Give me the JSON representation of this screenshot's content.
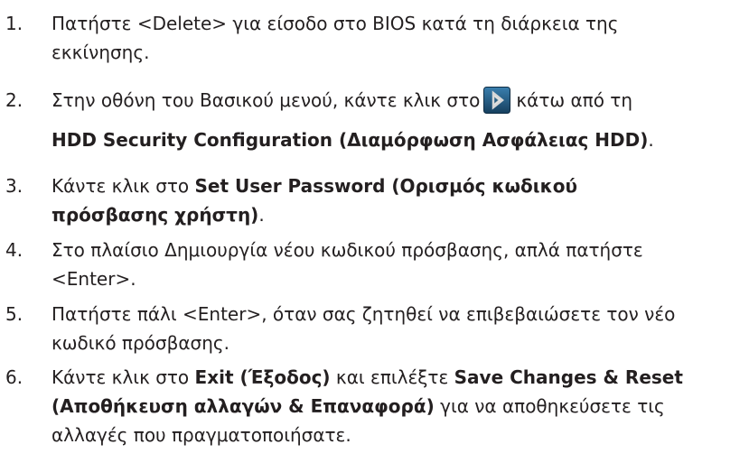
{
  "steps": [
    {
      "number": "1.",
      "lines": [
        "Πατήστε <Delete> για είσοδο στο BIOS κατά τη διάρκεια της",
        "εκκίνησης."
      ]
    },
    {
      "number": "2.",
      "line1_before": "Στην οθόνη του Βασικού μενού, κάντε κλικ στο",
      "line1_after": "κάτω από τη",
      "line2_bold": "HDD Security Configuration (Διαμόρφωση Ασφάλειας HDD)",
      "line2_tail": ".",
      "icon": "arrow-right-button-icon"
    },
    {
      "number": "3.",
      "plain": "Κάντε κλικ στο ",
      "bold1": "Set User Password (Ορισμός κωδικού",
      "bold2": "πρόσβασης χρήστη)",
      "tail": "."
    },
    {
      "number": "4.",
      "lines": [
        "Στο πλαίσιο Δημιουργία νέου κωδικού πρόσβασης, απλά πατήστε",
        "<Enter>."
      ]
    },
    {
      "number": "5.",
      "lines": [
        "Πατήστε πάλι <Enter>, όταν σας ζητηθεί να επιβεβαιώσετε τον νέο",
        "κωδικό πρόσβασης."
      ]
    },
    {
      "number": "6.",
      "p1": "Κάντε κλικ στο ",
      "b1": "Exit (Έξοδος)",
      "p2": " και επιλέξτε ",
      "b2": "Save Changes & Reset",
      "b3": "(Αποθήκευση αλλαγών & Επαναφορά)",
      "p3": " για να αποθηκεύσετε τις",
      "p4": "αλλαγές που πραγματοποιήσατε."
    }
  ],
  "colors": {
    "text": "#231f20",
    "icon_bg": "#1f5f87",
    "icon_fg": "#e6e6e6"
  }
}
